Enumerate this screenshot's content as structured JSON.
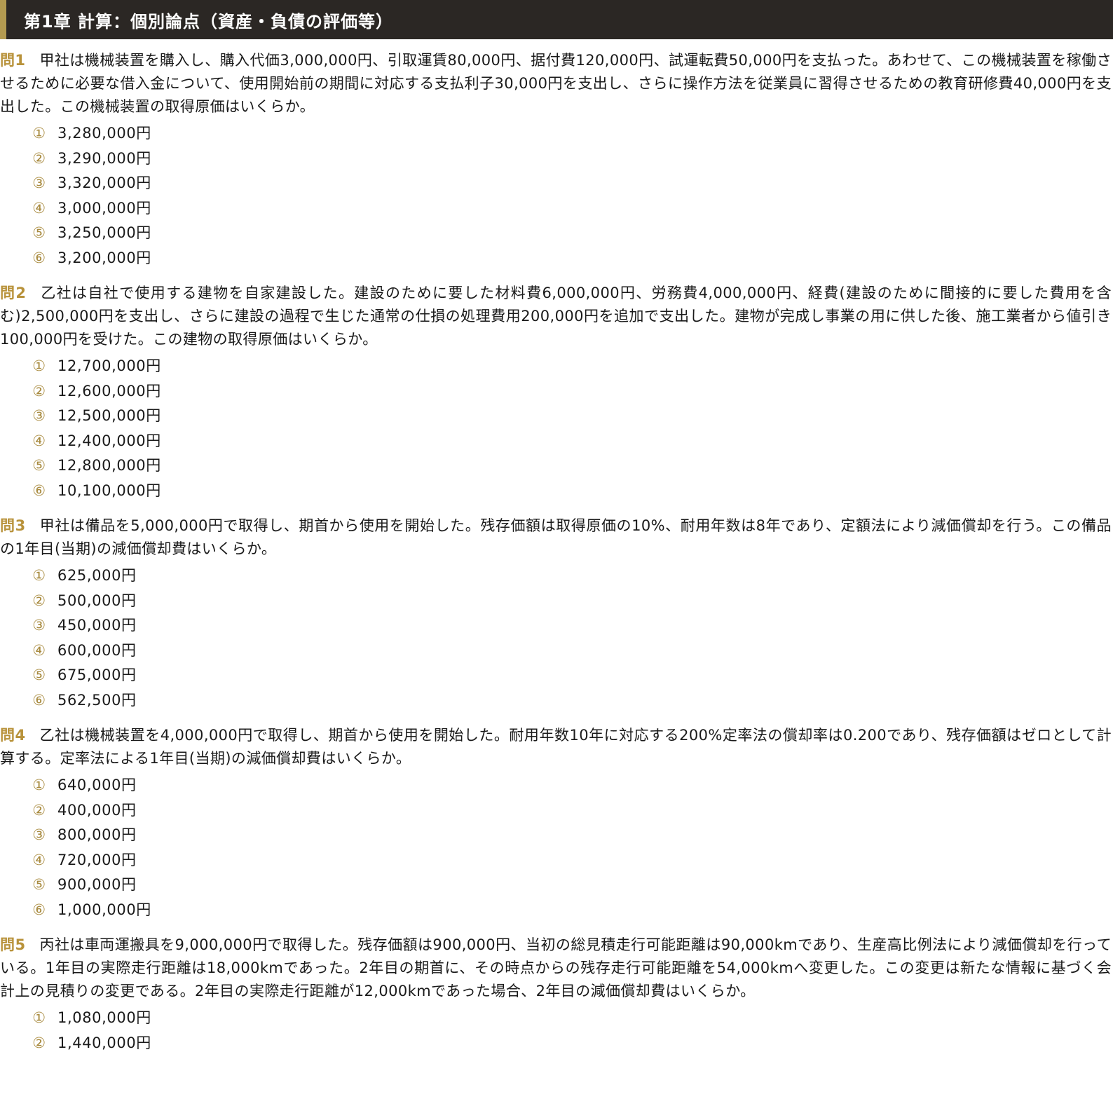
{
  "header": {
    "title": "第1章 計算：個別論点（資産・負債の評価等）"
  },
  "colors": {
    "header_bg": "#2b2724",
    "accent_gold": "#b39a50",
    "question_label": "#b8923a"
  },
  "questions": [
    {
      "label": "問1",
      "text": "甲社は機械装置を購入し、購入代価3,000,000円、引取運賃80,000円、据付費120,000円、試運転費50,000円を支払った。あわせて、この機械装置を稼働させるために必要な借入金について、使用開始前の期間に対応する支払利子30,000円を支出し、さらに操作方法を従業員に習得させるための教育研修費40,000円を支出した。この機械装置の取得原価はいくらか。",
      "choices": [
        {
          "marker": "①",
          "text": "3,280,000円"
        },
        {
          "marker": "②",
          "text": "3,290,000円"
        },
        {
          "marker": "③",
          "text": "3,320,000円"
        },
        {
          "marker": "④",
          "text": "3,000,000円"
        },
        {
          "marker": "⑤",
          "text": "3,250,000円"
        },
        {
          "marker": "⑥",
          "text": "3,200,000円"
        }
      ]
    },
    {
      "label": "問2",
      "text": "乙社は自社で使用する建物を自家建設した。建設のために要した材料費6,000,000円、労務費4,000,000円、経費(建設のために間接的に要した費用を含む)2,500,000円を支出し、さらに建設の過程で生じた通常の仕損の処理費用200,000円を追加で支出した。建物が完成し事業の用に供した後、施工業者から値引き100,000円を受けた。この建物の取得原価はいくらか。",
      "choices": [
        {
          "marker": "①",
          "text": "12,700,000円"
        },
        {
          "marker": "②",
          "text": "12,600,000円"
        },
        {
          "marker": "③",
          "text": "12,500,000円"
        },
        {
          "marker": "④",
          "text": "12,400,000円"
        },
        {
          "marker": "⑤",
          "text": "12,800,000円"
        },
        {
          "marker": "⑥",
          "text": "10,100,000円"
        }
      ]
    },
    {
      "label": "問3",
      "text": "甲社は備品を5,000,000円で取得し、期首から使用を開始した。残存価額は取得原価の10%、耐用年数は8年であり、定額法により減価償却を行う。この備品の1年目(当期)の減価償却費はいくらか。",
      "choices": [
        {
          "marker": "①",
          "text": "625,000円"
        },
        {
          "marker": "②",
          "text": "500,000円"
        },
        {
          "marker": "③",
          "text": "450,000円"
        },
        {
          "marker": "④",
          "text": "600,000円"
        },
        {
          "marker": "⑤",
          "text": "675,000円"
        },
        {
          "marker": "⑥",
          "text": "562,500円"
        }
      ]
    },
    {
      "label": "問4",
      "text": "乙社は機械装置を4,000,000円で取得し、期首から使用を開始した。耐用年数10年に対応する200%定率法の償却率は0.200であり、残存価額はゼロとして計算する。定率法による1年目(当期)の減価償却費はいくらか。",
      "choices": [
        {
          "marker": "①",
          "text": "640,000円"
        },
        {
          "marker": "②",
          "text": "400,000円"
        },
        {
          "marker": "③",
          "text": "800,000円"
        },
        {
          "marker": "④",
          "text": "720,000円"
        },
        {
          "marker": "⑤",
          "text": "900,000円"
        },
        {
          "marker": "⑥",
          "text": "1,000,000円"
        }
      ]
    },
    {
      "label": "問5",
      "text": "丙社は車両運搬具を9,000,000円で取得した。残存価額は900,000円、当初の総見積走行可能距離は90,000kmであり、生産高比例法により減価償却を行っている。1年目の実際走行距離は18,000kmであった。2年目の期首に、その時点からの残存走行可能距離を54,000kmへ変更した。この変更は新たな情報に基づく会計上の見積りの変更である。2年目の実際走行距離が12,000kmであった場合、2年目の減価償却費はいくらか。",
      "choices": [
        {
          "marker": "①",
          "text": "1,080,000円"
        },
        {
          "marker": "②",
          "text": "1,440,000円"
        }
      ]
    }
  ]
}
